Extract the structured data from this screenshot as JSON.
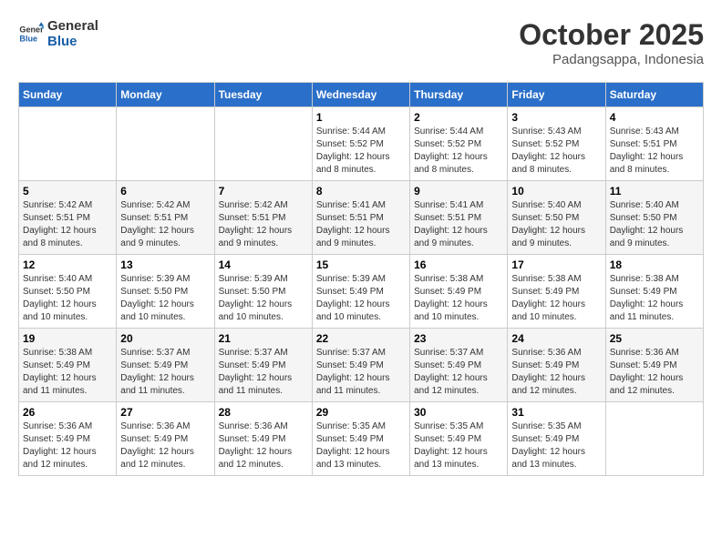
{
  "logo": {
    "line1": "General",
    "line2": "Blue"
  },
  "title": "October 2025",
  "location": "Padangsappa, Indonesia",
  "days_of_week": [
    "Sunday",
    "Monday",
    "Tuesday",
    "Wednesday",
    "Thursday",
    "Friday",
    "Saturday"
  ],
  "weeks": [
    [
      {
        "day": "",
        "info": ""
      },
      {
        "day": "",
        "info": ""
      },
      {
        "day": "",
        "info": ""
      },
      {
        "day": "1",
        "info": "Sunrise: 5:44 AM\nSunset: 5:52 PM\nDaylight: 12 hours and 8 minutes."
      },
      {
        "day": "2",
        "info": "Sunrise: 5:44 AM\nSunset: 5:52 PM\nDaylight: 12 hours and 8 minutes."
      },
      {
        "day": "3",
        "info": "Sunrise: 5:43 AM\nSunset: 5:52 PM\nDaylight: 12 hours and 8 minutes."
      },
      {
        "day": "4",
        "info": "Sunrise: 5:43 AM\nSunset: 5:51 PM\nDaylight: 12 hours and 8 minutes."
      }
    ],
    [
      {
        "day": "5",
        "info": "Sunrise: 5:42 AM\nSunset: 5:51 PM\nDaylight: 12 hours and 8 minutes."
      },
      {
        "day": "6",
        "info": "Sunrise: 5:42 AM\nSunset: 5:51 PM\nDaylight: 12 hours and 9 minutes."
      },
      {
        "day": "7",
        "info": "Sunrise: 5:42 AM\nSunset: 5:51 PM\nDaylight: 12 hours and 9 minutes."
      },
      {
        "day": "8",
        "info": "Sunrise: 5:41 AM\nSunset: 5:51 PM\nDaylight: 12 hours and 9 minutes."
      },
      {
        "day": "9",
        "info": "Sunrise: 5:41 AM\nSunset: 5:51 PM\nDaylight: 12 hours and 9 minutes."
      },
      {
        "day": "10",
        "info": "Sunrise: 5:40 AM\nSunset: 5:50 PM\nDaylight: 12 hours and 9 minutes."
      },
      {
        "day": "11",
        "info": "Sunrise: 5:40 AM\nSunset: 5:50 PM\nDaylight: 12 hours and 9 minutes."
      }
    ],
    [
      {
        "day": "12",
        "info": "Sunrise: 5:40 AM\nSunset: 5:50 PM\nDaylight: 12 hours and 10 minutes."
      },
      {
        "day": "13",
        "info": "Sunrise: 5:39 AM\nSunset: 5:50 PM\nDaylight: 12 hours and 10 minutes."
      },
      {
        "day": "14",
        "info": "Sunrise: 5:39 AM\nSunset: 5:50 PM\nDaylight: 12 hours and 10 minutes."
      },
      {
        "day": "15",
        "info": "Sunrise: 5:39 AM\nSunset: 5:49 PM\nDaylight: 12 hours and 10 minutes."
      },
      {
        "day": "16",
        "info": "Sunrise: 5:38 AM\nSunset: 5:49 PM\nDaylight: 12 hours and 10 minutes."
      },
      {
        "day": "17",
        "info": "Sunrise: 5:38 AM\nSunset: 5:49 PM\nDaylight: 12 hours and 10 minutes."
      },
      {
        "day": "18",
        "info": "Sunrise: 5:38 AM\nSunset: 5:49 PM\nDaylight: 12 hours and 11 minutes."
      }
    ],
    [
      {
        "day": "19",
        "info": "Sunrise: 5:38 AM\nSunset: 5:49 PM\nDaylight: 12 hours and 11 minutes."
      },
      {
        "day": "20",
        "info": "Sunrise: 5:37 AM\nSunset: 5:49 PM\nDaylight: 12 hours and 11 minutes."
      },
      {
        "day": "21",
        "info": "Sunrise: 5:37 AM\nSunset: 5:49 PM\nDaylight: 12 hours and 11 minutes."
      },
      {
        "day": "22",
        "info": "Sunrise: 5:37 AM\nSunset: 5:49 PM\nDaylight: 12 hours and 11 minutes."
      },
      {
        "day": "23",
        "info": "Sunrise: 5:37 AM\nSunset: 5:49 PM\nDaylight: 12 hours and 12 minutes."
      },
      {
        "day": "24",
        "info": "Sunrise: 5:36 AM\nSunset: 5:49 PM\nDaylight: 12 hours and 12 minutes."
      },
      {
        "day": "25",
        "info": "Sunrise: 5:36 AM\nSunset: 5:49 PM\nDaylight: 12 hours and 12 minutes."
      }
    ],
    [
      {
        "day": "26",
        "info": "Sunrise: 5:36 AM\nSunset: 5:49 PM\nDaylight: 12 hours and 12 minutes."
      },
      {
        "day": "27",
        "info": "Sunrise: 5:36 AM\nSunset: 5:49 PM\nDaylight: 12 hours and 12 minutes."
      },
      {
        "day": "28",
        "info": "Sunrise: 5:36 AM\nSunset: 5:49 PM\nDaylight: 12 hours and 12 minutes."
      },
      {
        "day": "29",
        "info": "Sunrise: 5:35 AM\nSunset: 5:49 PM\nDaylight: 12 hours and 13 minutes."
      },
      {
        "day": "30",
        "info": "Sunrise: 5:35 AM\nSunset: 5:49 PM\nDaylight: 12 hours and 13 minutes."
      },
      {
        "day": "31",
        "info": "Sunrise: 5:35 AM\nSunset: 5:49 PM\nDaylight: 12 hours and 13 minutes."
      },
      {
        "day": "",
        "info": ""
      }
    ]
  ]
}
